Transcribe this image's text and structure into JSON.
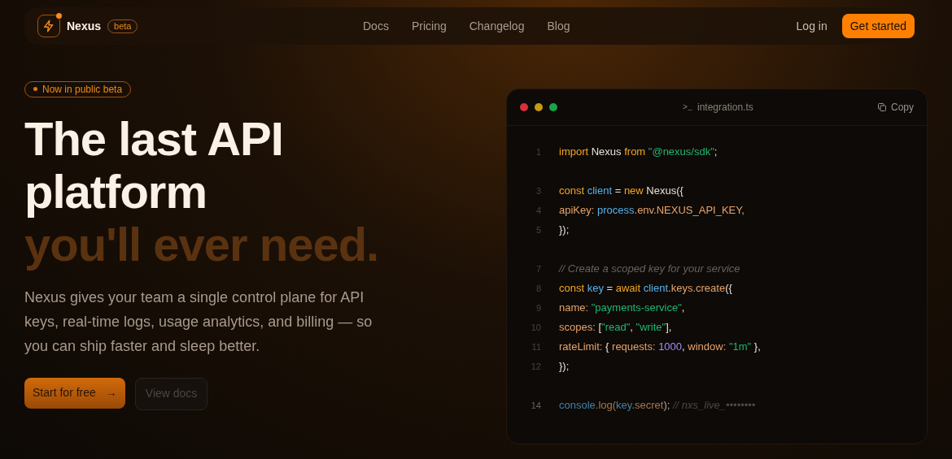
{
  "nav": {
    "brand": "Nexus",
    "badge": "beta",
    "links": [
      "Docs",
      "Pricing",
      "Changelog",
      "Blog"
    ],
    "login": "Log in",
    "cta": "Get started"
  },
  "hero": {
    "pill": "Now in public beta",
    "headline": [
      {
        "text": "The last API",
        "kind": "plain"
      },
      {
        "text": "platform",
        "kind": "plain"
      },
      {
        "text": "you'll ever need.",
        "kind": "accent"
      }
    ],
    "description": "Nexus gives your team a single control plane for API keys, real-time logs, usage analytics, and billing — so you can ship faster and sleep better.",
    "buttons": [
      {
        "label": "Start for free",
        "kind": "primary",
        "arrow": "→"
      },
      {
        "label": "View docs",
        "kind": "secondary"
      }
    ]
  },
  "code_window": {
    "filename": "integration.ts",
    "prompt": ">_",
    "copy": "Copy",
    "lines": [
      {
        "number": "1",
        "faded": false,
        "tokens": [
          {
            "text": "import ",
            "kind": "keyword"
          },
          {
            "text": "Nexus ",
            "kind": "plain"
          },
          {
            "text": "from ",
            "kind": "keyword"
          },
          {
            "text": "\"@nexus/sdk\"",
            "kind": "string"
          },
          {
            "text": ";",
            "kind": "plain"
          }
        ]
      },
      {
        "kind": "blank"
      },
      {
        "number": "3",
        "faded": false,
        "tokens": [
          {
            "text": "const ",
            "kind": "keyword"
          },
          {
            "text": "client",
            "kind": "variable"
          },
          {
            "text": " = ",
            "kind": "plain"
          },
          {
            "text": "new ",
            "kind": "keyword"
          },
          {
            "text": "Nexus({",
            "kind": "plain"
          }
        ]
      },
      {
        "number": "4",
        "faded": false,
        "tokens": [
          {
            "text": "apiKey: ",
            "kind": "prop"
          },
          {
            "text": "process",
            "kind": "variable"
          },
          {
            "text": ".env.NEXUS_API_KEY,",
            "kind": "prop"
          }
        ]
      },
      {
        "number": "5",
        "faded": false,
        "tokens": [
          {
            "text": "});",
            "kind": "plain"
          }
        ]
      },
      {
        "kind": "blank"
      },
      {
        "number": "7",
        "faded": false,
        "tokens": [
          {
            "text": "// Create a scoped key for your service",
            "kind": "comment"
          }
        ]
      },
      {
        "number": "8",
        "faded": false,
        "tokens": [
          {
            "text": "const ",
            "kind": "keyword"
          },
          {
            "text": "key",
            "kind": "variable"
          },
          {
            "text": " = ",
            "kind": "plain"
          },
          {
            "text": "await ",
            "kind": "keyword"
          },
          {
            "text": "client",
            "kind": "variable"
          },
          {
            "text": ".keys.create",
            "kind": "prop"
          },
          {
            "text": "({",
            "kind": "plain"
          }
        ]
      },
      {
        "number": "9",
        "faded": false,
        "tokens": [
          {
            "text": "name: ",
            "kind": "prop"
          },
          {
            "text": "\"payments-service\"",
            "kind": "string"
          },
          {
            "text": ",",
            "kind": "plain"
          }
        ]
      },
      {
        "number": "10",
        "faded": false,
        "tokens": [
          {
            "text": "scopes: ",
            "kind": "prop"
          },
          {
            "text": "[",
            "kind": "plain"
          },
          {
            "text": "\"read\"",
            "kind": "string"
          },
          {
            "text": ", ",
            "kind": "plain"
          },
          {
            "text": "\"write\"",
            "kind": "string"
          },
          {
            "text": "],",
            "kind": "plain"
          }
        ]
      },
      {
        "number": "11",
        "faded": false,
        "tokens": [
          {
            "text": "rateLimit: ",
            "kind": "prop"
          },
          {
            "text": "{ ",
            "kind": "plain"
          },
          {
            "text": "requests: ",
            "kind": "prop"
          },
          {
            "text": "1000",
            "kind": "number"
          },
          {
            "text": ", ",
            "kind": "plain"
          },
          {
            "text": "window: ",
            "kind": "prop"
          },
          {
            "text": "\"1m\"",
            "kind": "string"
          },
          {
            "text": " },",
            "kind": "plain"
          }
        ]
      },
      {
        "number": "12",
        "faded": false,
        "tokens": [
          {
            "text": "});",
            "kind": "plain"
          }
        ]
      },
      {
        "kind": "blank"
      },
      {
        "number": "14",
        "faded": true,
        "tokens": [
          {
            "text": "console",
            "kind": "variable"
          },
          {
            "text": ".log(",
            "kind": "prop"
          },
          {
            "text": "key",
            "kind": "variable"
          },
          {
            "text": ".secret",
            "kind": "prop"
          },
          {
            "text": "); ",
            "kind": "plain"
          },
          {
            "text": "// nxs_live_••••••••",
            "kind": "comment"
          }
        ]
      }
    ]
  }
}
